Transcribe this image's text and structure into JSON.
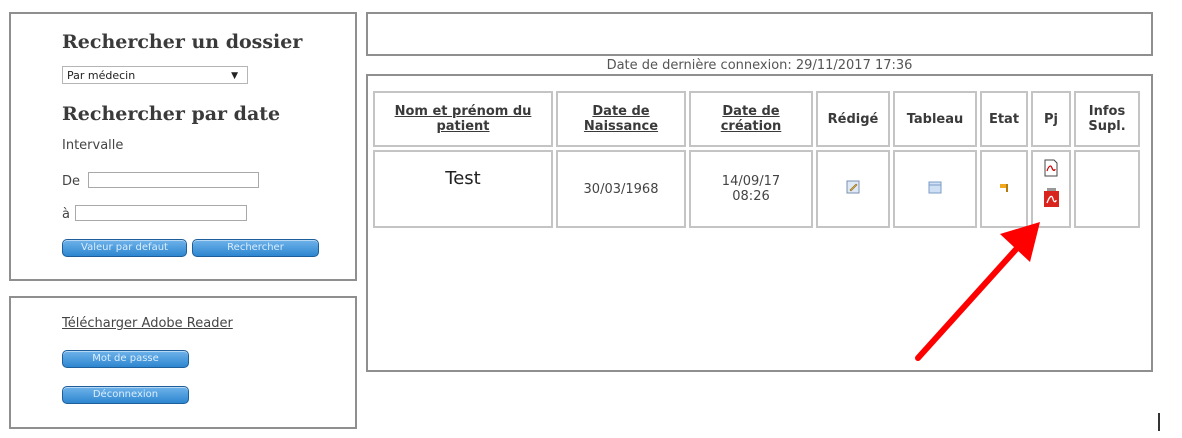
{
  "sidebar": {
    "search_title": "Rechercher un dossier",
    "search_by": {
      "selected": "Par médecin"
    },
    "date_title": "Rechercher par date",
    "interval_label": "Intervalle",
    "from_label": "De",
    "from_value": "",
    "to_label": "à",
    "to_value": "",
    "default_button": "Valeur par defaut",
    "search_button": "Rechercher"
  },
  "tools": {
    "adobe_link": "Télécharger Adobe Reader",
    "password_button": "Mot de passe",
    "logout_button": "Déconnexion"
  },
  "main": {
    "last_login": "Date de dernière connexion: 29/11/2017  17:36",
    "table": {
      "headers": {
        "patient": "Nom et prénom du patient",
        "birth": "Date de Naissance",
        "created": "Date de création",
        "written": "Rédigé",
        "board": "Tableau",
        "state": "Etat",
        "attachment": "Pj",
        "info": "Infos Supl."
      },
      "rows": [
        {
          "patient": "Test",
          "birth": "30/03/1968",
          "created_date": "14/09/17",
          "created_time": "08:26",
          "info": ""
        }
      ]
    }
  },
  "icons": {
    "edit": "edit-icon",
    "board": "table-icon",
    "state": "flag-icon",
    "pdf_doc": "pdf-document-icon",
    "pdf_acrobat": "pdf-acrobat-icon"
  },
  "colors": {
    "button_blue": "#2e86cf",
    "arrow_red": "#ff0000",
    "border_gray": "#8f8f8f"
  }
}
